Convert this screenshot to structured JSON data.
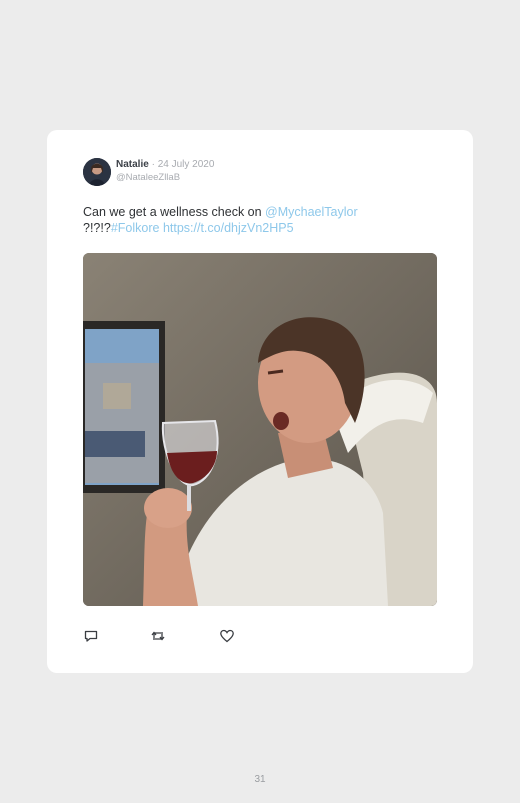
{
  "tweet": {
    "author_name": "Natalie",
    "date_separator": "·",
    "date": "24 July 2020",
    "handle": "@NataleeZllaB",
    "text_prefix": "Can we get a wellness check on ",
    "mention": "@MychaelTaylor",
    "text_mid": "?!?!?",
    "hashtag": "#Folkore",
    "link": "https://t.co/dhjzVn2HP5"
  },
  "media": {
    "icon": "photo-media"
  },
  "actions": [
    {
      "name": "reply",
      "icon": "speech-bubble-icon"
    },
    {
      "name": "retweet",
      "icon": "retweet-icon"
    },
    {
      "name": "like",
      "icon": "heart-icon"
    }
  ],
  "page": {
    "number": "31"
  },
  "colors": {
    "background": "#ececec",
    "card": "#ffffff",
    "link": "#8ec8ea",
    "muted": "#a8abb0"
  }
}
